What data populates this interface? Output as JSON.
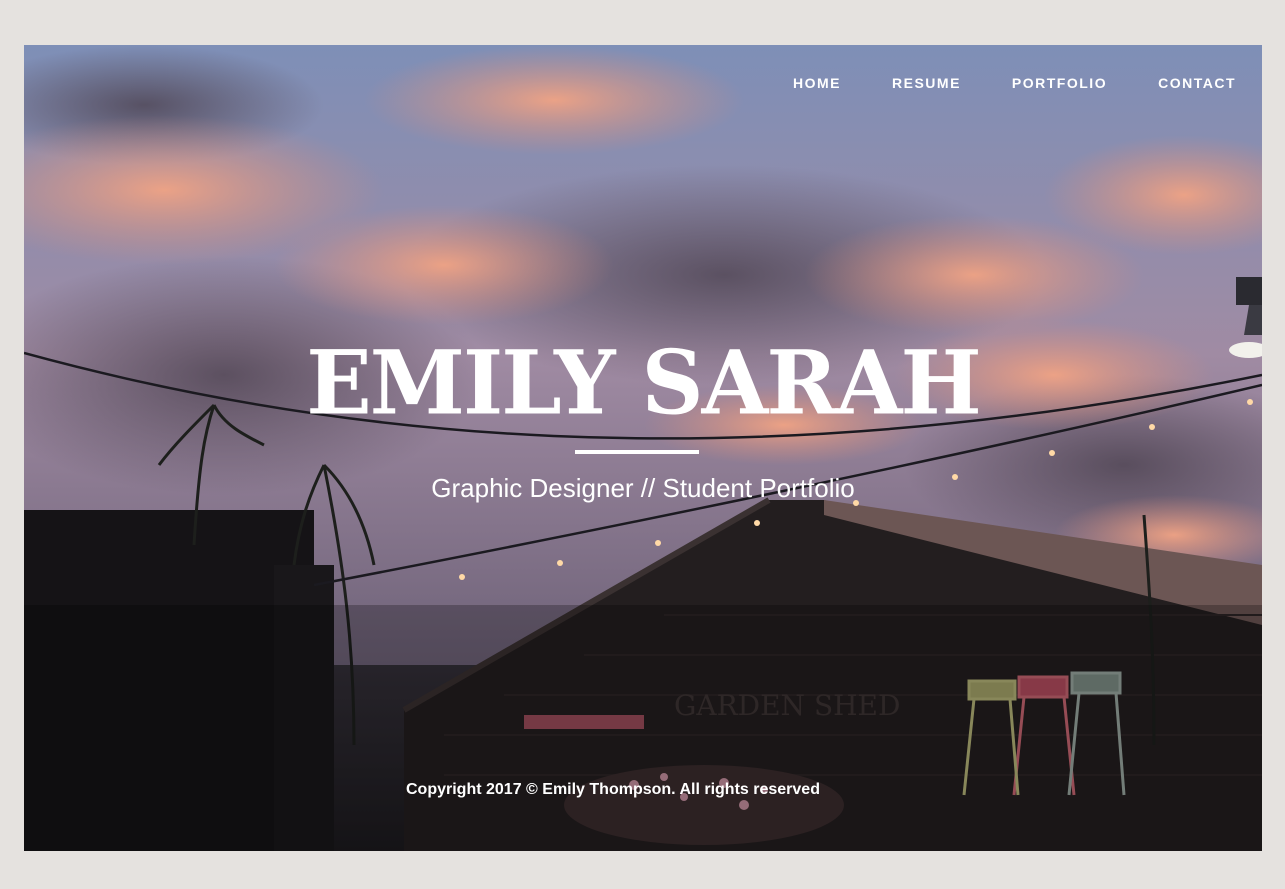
{
  "nav": {
    "items": [
      {
        "label": "HOME"
      },
      {
        "label": "RESUME"
      },
      {
        "label": "PORTFOLIO"
      },
      {
        "label": "CONTACT"
      }
    ]
  },
  "hero": {
    "title": "EMILY SARAH",
    "subtitle": "Graphic Designer // Student Portfolio",
    "sign_text": "GARDEN SHED"
  },
  "footer": {
    "copyright": "Copyright 2017 © Emily Thompson. All rights reserved"
  },
  "colors": {
    "page_background": "#e5e2df",
    "text": "#ffffff",
    "cloud": "#e89a80"
  }
}
